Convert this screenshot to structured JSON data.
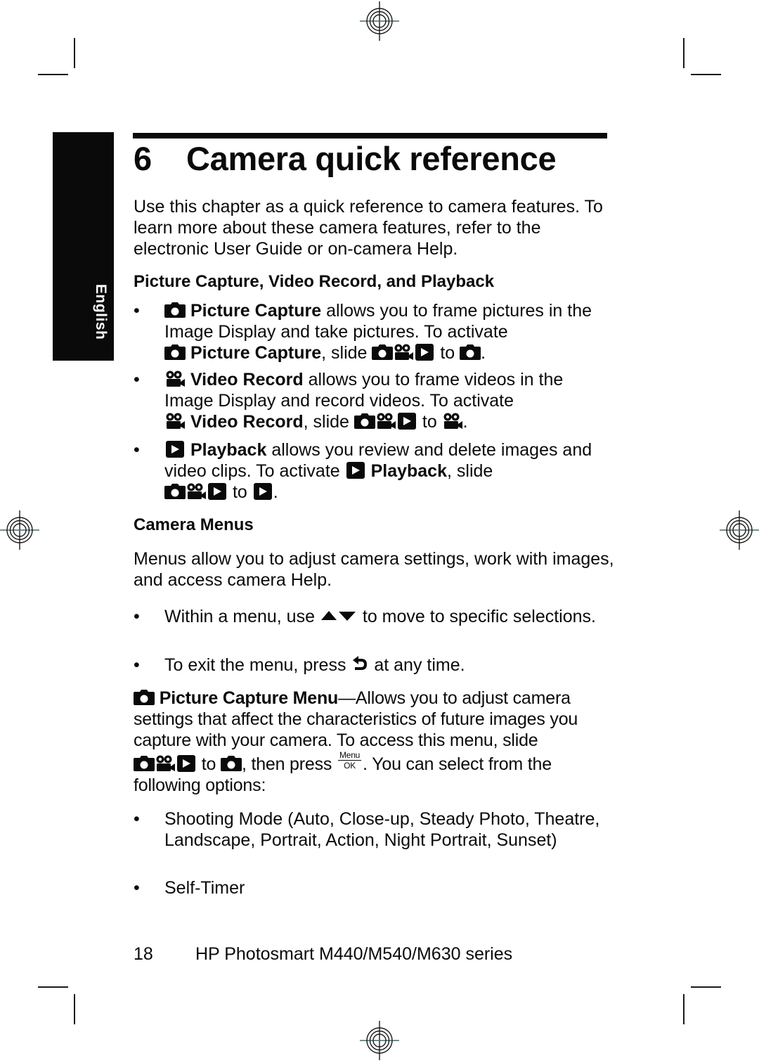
{
  "side_tab": {
    "label": "English"
  },
  "chapter": {
    "number": "6",
    "title": "Camera quick reference"
  },
  "intro": "Use this chapter as a quick reference to camera features. To learn more about these camera features, refer to the electronic User Guide or on-camera Help.",
  "section1": {
    "heading": "Picture Capture, Video Record, and Playback",
    "items": [
      {
        "icon": "camera-icon",
        "name": "Picture Capture",
        "desc": " allows you to frame pictures in the Image Display and take pictures. To activate ",
        "name2": "Picture Capture",
        "slide_text": ", slide ",
        "to_text": " to ",
        "end": "."
      },
      {
        "icon": "video-camera-icon",
        "name": "Video Record",
        "desc": " allows you to frame videos in the Image Display and record videos. To activate ",
        "name2": "Video Record",
        "slide_text": ", slide ",
        "to_text": " to ",
        "end": "."
      },
      {
        "icon": "playback-icon",
        "name": "Playback",
        "desc": " allows you review and delete images and video clips. To activate ",
        "name2": "Playback",
        "slide_text": ", slide",
        "to_text": " to ",
        "end": "."
      }
    ]
  },
  "section2": {
    "heading": "Camera Menus",
    "intro": "Menus allow you to adjust camera settings, work with images, and access camera Help.",
    "bullets": [
      {
        "pre": "Within a menu, use ",
        "icon": "up-down-arrows-icon",
        "post": " to move to specific selections."
      },
      {
        "pre": "To exit the menu, press ",
        "icon": "back-icon",
        "post": " at any time."
      }
    ],
    "picture_capture_menu": {
      "title": "Picture Capture Menu",
      "dash_text": "—Allows you to adjust camera settings that affect the characteristics of future images you capture with your camera. To access this menu, slide",
      "to_text": " to ",
      "then_press": ", then press ",
      "menu_ok_top": "Menu",
      "menu_ok_bottom": "OK",
      "tail": ". You can select from the following options:"
    },
    "options": [
      "Shooting Mode (Auto, Close-up, Steady Photo, Theatre, Landscape, Portrait, Action, Night Portrait, Sunset)",
      "Self-Timer"
    ]
  },
  "bullet_char": "•",
  "footer": {
    "page_number": "18",
    "title": "HP Photosmart M440/M540/M630 series"
  }
}
